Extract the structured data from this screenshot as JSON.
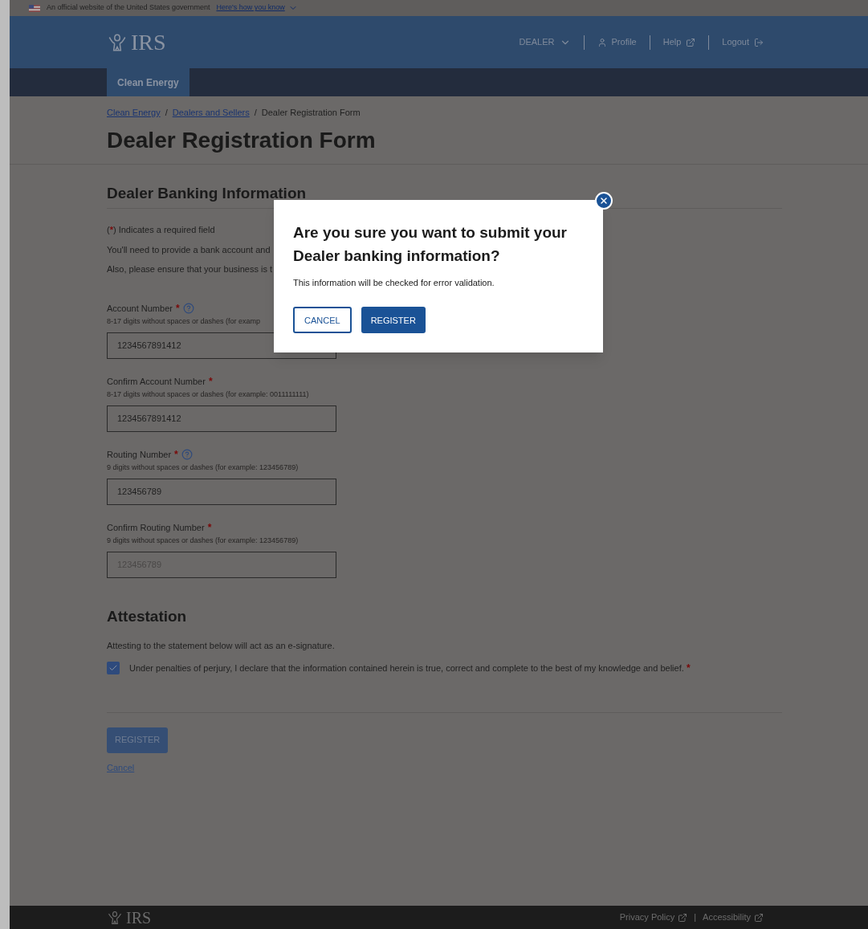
{
  "banner": {
    "text": "An official website of the United States government",
    "link": "Here's how you know"
  },
  "header": {
    "logo": "IRS",
    "menu": [
      {
        "kind": "dropdown",
        "label": "DEALER"
      },
      {
        "kind": "profile",
        "label": "Profile"
      },
      {
        "kind": "external",
        "label": "Help"
      },
      {
        "kind": "logout",
        "label": "Logout"
      }
    ]
  },
  "nav": {
    "tabs": [
      {
        "label": "Clean Energy",
        "selected": true
      }
    ]
  },
  "breadcrumb": [
    {
      "label": "Clean Energy",
      "link": true
    },
    {
      "label": "Dealers and Sellers",
      "link": true
    },
    {
      "label": "Dealer Registration Form",
      "link": false
    }
  ],
  "breadcrumb_separator": "/",
  "title": "Dealer Registration Form",
  "required_mark": "*",
  "section": {
    "heading": "Dealer Banking Information",
    "required_note": [
      "(",
      ") Indicates a required field"
    ],
    "lines": [
      "You'll need to provide a bank account and",
      "Also, please ensure that your business is t"
    ],
    "fields": [
      {
        "label": "Account Number",
        "required": true,
        "help": true,
        "hint": "8-17 digits without spaces or dashes (for examp",
        "value": "1234567891412"
      },
      {
        "label": "Confirm Account Number",
        "required": true,
        "help": false,
        "hint": "8-17 digits without spaces or dashes (for example: 0011111111)",
        "value": "1234567891412"
      },
      {
        "label": "Routing Number",
        "required": true,
        "help": true,
        "hint": "9 digits without spaces or dashes (for example: 123456789)",
        "value": "123456789"
      },
      {
        "label": "Confirm Routing Number",
        "required": true,
        "help": false,
        "hint": "9 digits without spaces or dashes (for example: 123456789)",
        "placeholder": "123456789"
      }
    ]
  },
  "attestation": {
    "heading": "Attestation",
    "intro": "Attesting to the statement below will act as an e-signature.",
    "checkbox": {
      "checked": true,
      "required": true,
      "label": "Under penalties of perjury, I declare that the information contained herein is true, correct and complete to the best of my knowledge and belief."
    }
  },
  "actions": {
    "register": {
      "label": "REGISTER",
      "disabled": true
    },
    "cancel": "Cancel"
  },
  "modal": {
    "title": "Are you sure you want to submit your Dealer banking information?",
    "body": "This information will be checked for error validation.",
    "buttons": [
      {
        "kind": "secondary",
        "label": "CANCEL"
      },
      {
        "kind": "primary",
        "label": "REGISTER"
      }
    ]
  },
  "footer": {
    "logo": "IRS",
    "links": [
      "Privacy Policy",
      "Accessibility"
    ],
    "separator": "|"
  }
}
